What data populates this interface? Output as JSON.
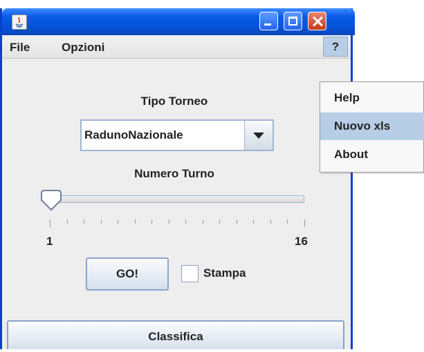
{
  "menubar": {
    "file": "File",
    "opzioni": "Opzioni",
    "help": "?"
  },
  "main": {
    "tipo_torneo_label": "Tipo Torneo",
    "tipo_torneo_value": "RadunoNazionale",
    "numero_turno_label": "Numero Turno",
    "slider": {
      "min_label": "1",
      "max_label": "16",
      "value": 1,
      "min": 1,
      "max": 16
    },
    "go_button": "GO!",
    "stampa_label": "Stampa",
    "stampa_checked": false,
    "classifica_button": "Classifica"
  },
  "popup_menu": {
    "items": [
      {
        "label": "Help",
        "selected": false
      },
      {
        "label": "Nuovo xls",
        "selected": true
      },
      {
        "label": "About",
        "selected": false
      }
    ]
  },
  "colors": {
    "titlebar": "#0a5ce8",
    "close_button": "#c6391c",
    "selection": "#b8cde6"
  }
}
